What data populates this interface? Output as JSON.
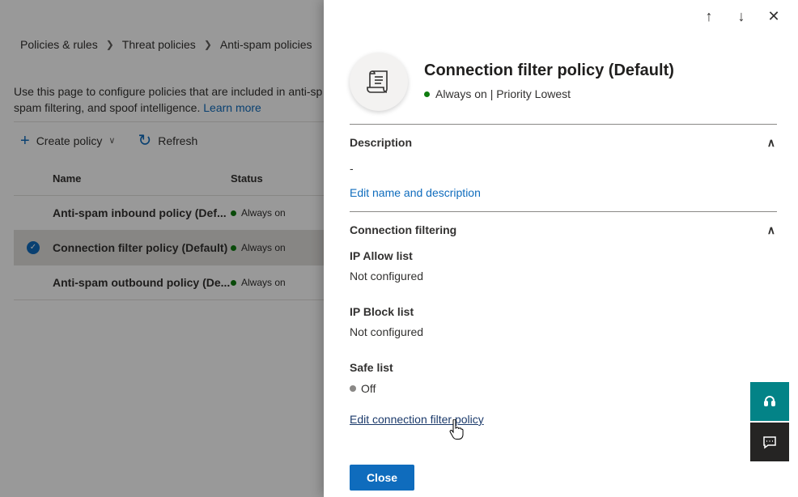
{
  "breadcrumb": [
    "Policies & rules",
    "Threat policies",
    "Anti-spam policies"
  ],
  "intro": {
    "line1": "Use this page to configure policies that are included in anti-sp",
    "line2": "spam filtering, and spoof intelligence.",
    "learn_more": "Learn more"
  },
  "toolbar": {
    "create_label": "Create policy",
    "refresh_label": "Refresh"
  },
  "table": {
    "headers": {
      "name": "Name",
      "status": "Status"
    },
    "rows": [
      {
        "name": "Anti-spam inbound policy (Def...",
        "status": "Always on",
        "selected": false
      },
      {
        "name": "Connection filter policy (Default)",
        "status": "Always on",
        "selected": true
      },
      {
        "name": "Anti-spam outbound policy (De...",
        "status": "Always on",
        "selected": false
      }
    ]
  },
  "panel": {
    "title": "Connection filter policy (Default)",
    "status": "Always on | Priority Lowest",
    "description": {
      "heading": "Description",
      "value": "-",
      "edit_link": "Edit name and description"
    },
    "connection_filtering": {
      "heading": "Connection filtering",
      "ip_allow_label": "IP Allow list",
      "ip_allow_value": "Not configured",
      "ip_block_label": "IP Block list",
      "ip_block_value": "Not configured",
      "safe_list_label": "Safe list",
      "safe_list_value": "Off",
      "edit_link": "Edit connection filter policy"
    },
    "close_label": "Close"
  },
  "colors": {
    "accent": "#0f6cbd",
    "status_on": "#107c10",
    "help_button": "#038387"
  },
  "icons": [
    "chevron-right-icon",
    "plus-icon",
    "chevron-down-icon",
    "refresh-icon",
    "checkmark-icon",
    "arrow-up-icon",
    "arrow-down-icon",
    "close-icon",
    "scroll-policy-icon",
    "chevron-up-icon",
    "headset-help-icon",
    "feedback-icon",
    "hand-cursor-icon"
  ]
}
